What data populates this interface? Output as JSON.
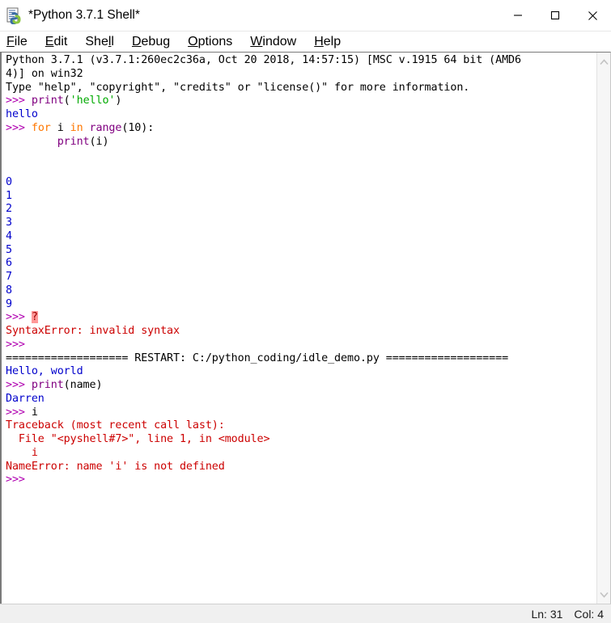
{
  "window": {
    "title": "*Python 3.7.1 Shell*",
    "icon": "idle-python-icon",
    "controls": {
      "minimize": "minimize-icon",
      "maximize": "maximize-icon",
      "close": "close-icon"
    }
  },
  "menubar": {
    "items": [
      {
        "label": "File",
        "mnemonic": "F"
      },
      {
        "label": "Edit",
        "mnemonic": "E"
      },
      {
        "label": "Shell",
        "mnemonic": "l"
      },
      {
        "label": "Debug",
        "mnemonic": "D"
      },
      {
        "label": "Options",
        "mnemonic": "O"
      },
      {
        "label": "Window",
        "mnemonic": "W"
      },
      {
        "label": "Help",
        "mnemonic": "H"
      }
    ]
  },
  "colors": {
    "prompt": "#b000b0",
    "builtin": "#800080",
    "keyword": "#ff7700",
    "string": "#00aa00",
    "output": "#0000cc",
    "error": "#cc0000",
    "plain": "#000000",
    "error_highlight_bg": "#ff9999",
    "error_highlight_fg": "#990000"
  },
  "shell": {
    "lines": [
      {
        "segments": [
          {
            "text": "Python 3.7.1 (v3.7.1:260ec2c36a, Oct 20 2018, 14:57:15) [MSC v.1915 64 bit (AMD6",
            "color": "plain"
          }
        ]
      },
      {
        "segments": [
          {
            "text": "4)] on win32",
            "color": "plain"
          }
        ]
      },
      {
        "segments": [
          {
            "text": "Type \"help\", \"copyright\", \"credits\" or \"license()\" for more information.",
            "color": "plain"
          }
        ]
      },
      {
        "segments": [
          {
            "text": ">>> ",
            "color": "prompt"
          },
          {
            "text": "print",
            "color": "builtin"
          },
          {
            "text": "(",
            "color": "plain"
          },
          {
            "text": "'hello'",
            "color": "string"
          },
          {
            "text": ")",
            "color": "plain"
          }
        ]
      },
      {
        "segments": [
          {
            "text": "hello",
            "color": "output"
          }
        ]
      },
      {
        "segments": [
          {
            "text": ">>> ",
            "color": "prompt"
          },
          {
            "text": "for",
            "color": "keyword"
          },
          {
            "text": " i ",
            "color": "plain"
          },
          {
            "text": "in",
            "color": "keyword"
          },
          {
            "text": " ",
            "color": "plain"
          },
          {
            "text": "range",
            "color": "builtin"
          },
          {
            "text": "(10):",
            "color": "plain"
          }
        ]
      },
      {
        "segments": [
          {
            "text": "        ",
            "color": "plain"
          },
          {
            "text": "print",
            "color": "builtin"
          },
          {
            "text": "(i)",
            "color": "plain"
          }
        ]
      },
      {
        "segments": [
          {
            "text": "",
            "color": "plain"
          }
        ]
      },
      {
        "segments": [
          {
            "text": "",
            "color": "plain"
          }
        ]
      },
      {
        "segments": [
          {
            "text": "0",
            "color": "output"
          }
        ]
      },
      {
        "segments": [
          {
            "text": "1",
            "color": "output"
          }
        ]
      },
      {
        "segments": [
          {
            "text": "2",
            "color": "output"
          }
        ]
      },
      {
        "segments": [
          {
            "text": "3",
            "color": "output"
          }
        ]
      },
      {
        "segments": [
          {
            "text": "4",
            "color": "output"
          }
        ]
      },
      {
        "segments": [
          {
            "text": "5",
            "color": "output"
          }
        ]
      },
      {
        "segments": [
          {
            "text": "6",
            "color": "output"
          }
        ]
      },
      {
        "segments": [
          {
            "text": "7",
            "color": "output"
          }
        ]
      },
      {
        "segments": [
          {
            "text": "8",
            "color": "output"
          }
        ]
      },
      {
        "segments": [
          {
            "text": "9",
            "color": "output"
          }
        ]
      },
      {
        "segments": [
          {
            "text": ">>> ",
            "color": "prompt"
          },
          {
            "text": "?",
            "color": "error_highlight",
            "highlight": true
          }
        ]
      },
      {
        "segments": [
          {
            "text": "SyntaxError: invalid syntax",
            "color": "error"
          }
        ]
      },
      {
        "segments": [
          {
            "text": ">>> ",
            "color": "prompt"
          }
        ]
      },
      {
        "segments": [
          {
            "text": "=================== RESTART: C:/python_coding/idle_demo.py ===================",
            "color": "plain"
          }
        ]
      },
      {
        "segments": [
          {
            "text": "Hello, world",
            "color": "output"
          }
        ]
      },
      {
        "segments": [
          {
            "text": ">>> ",
            "color": "prompt"
          },
          {
            "text": "print",
            "color": "builtin"
          },
          {
            "text": "(name)",
            "color": "plain"
          }
        ]
      },
      {
        "segments": [
          {
            "text": "Darren",
            "color": "output"
          }
        ]
      },
      {
        "segments": [
          {
            "text": ">>> ",
            "color": "prompt"
          },
          {
            "text": "i",
            "color": "plain"
          }
        ]
      },
      {
        "segments": [
          {
            "text": "Traceback (most recent call last):",
            "color": "error"
          }
        ]
      },
      {
        "segments": [
          {
            "text": "  File \"<pyshell#7>\", line 1, in <module>",
            "color": "error"
          }
        ]
      },
      {
        "segments": [
          {
            "text": "    i",
            "color": "error"
          }
        ]
      },
      {
        "segments": [
          {
            "text": "NameError: name 'i' is not defined",
            "color": "error"
          }
        ]
      },
      {
        "segments": [
          {
            "text": ">>> ",
            "color": "prompt"
          }
        ]
      }
    ]
  },
  "scrollbar": {
    "up_arrow": "chevron-up-icon",
    "down_arrow": "chevron-down-icon"
  },
  "statusbar": {
    "line": "Ln: 31",
    "col": "Col: 4"
  }
}
